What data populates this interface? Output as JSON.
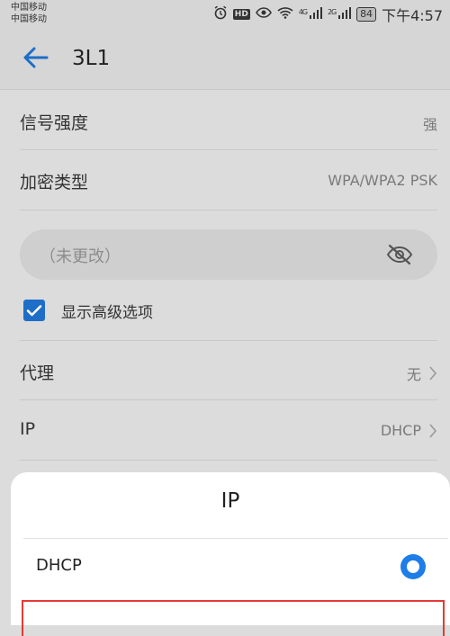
{
  "status_bar": {
    "carrier1": "中国移动",
    "carrier2": "中国移动",
    "net1": "4G",
    "net2": "2G",
    "battery": "84",
    "time": "下午4:57",
    "hd": "HD"
  },
  "app_bar": {
    "title": "3L1"
  },
  "rows": {
    "signal": {
      "label": "信号强度",
      "value": "强"
    },
    "encryption": {
      "label": "加密类型",
      "value": "WPA/WPA2 PSK"
    },
    "proxy": {
      "label": "代理",
      "value": "无"
    },
    "ip": {
      "label": "IP",
      "value": "DHCP"
    }
  },
  "password": {
    "placeholder": "（未更改）"
  },
  "advanced": {
    "label": "显示高级选项",
    "checked": true
  },
  "dialog": {
    "title": "IP",
    "options": [
      {
        "label": "DHCP",
        "selected": true
      }
    ]
  },
  "colors": {
    "accent": "#1e7de6",
    "highlight": "#e53935"
  }
}
